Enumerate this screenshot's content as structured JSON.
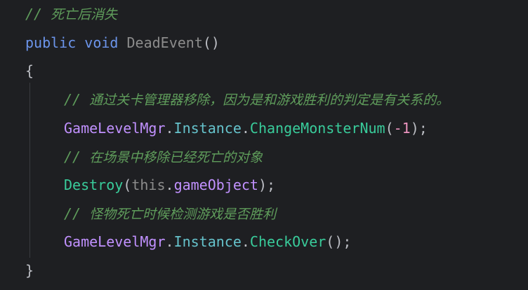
{
  "code": {
    "line1": {
      "comment_mark": "//",
      "comment_text": "死亡后消失"
    },
    "line2": {
      "kw_public": "public",
      "kw_void": "void",
      "method_name": "DeadEvent",
      "parens": "()"
    },
    "line3": {
      "brace": "{"
    },
    "line4": {
      "comment_mark": "//",
      "comment_text": "通过关卡管理器移除，因为是和游戏胜利的判定是有关系的。"
    },
    "line5": {
      "class_name": "GameLevelMgr",
      "dot1": ".",
      "property": "Instance",
      "dot2": ".",
      "method": "ChangeMonsterNum",
      "open": "(",
      "arg": "-1",
      "close": ");"
    },
    "line6": {
      "comment_mark": "//",
      "comment_text": "在场景中移除已经死亡的对象"
    },
    "line7": {
      "method": "Destroy",
      "open": "(",
      "this_kw": "this",
      "dot": ".",
      "field": "gameObject",
      "close": ");"
    },
    "line8": {
      "comment_mark": "//",
      "comment_text": "怪物死亡时候检测游戏是否胜利"
    },
    "line9": {
      "class_name": "GameLevelMgr",
      "dot1": ".",
      "property": "Instance",
      "dot2": ".",
      "method": "CheckOver",
      "close": "();"
    },
    "line10": {
      "brace": "}"
    }
  },
  "colors": {
    "background": "#1e1f22",
    "comment": "#5f9d5b",
    "keyword": "#6c95eb",
    "class": "#c191ff",
    "property": "#66c3cc",
    "method": "#39cc9b",
    "number": "#ed94c0",
    "plain": "#bcbec4"
  }
}
